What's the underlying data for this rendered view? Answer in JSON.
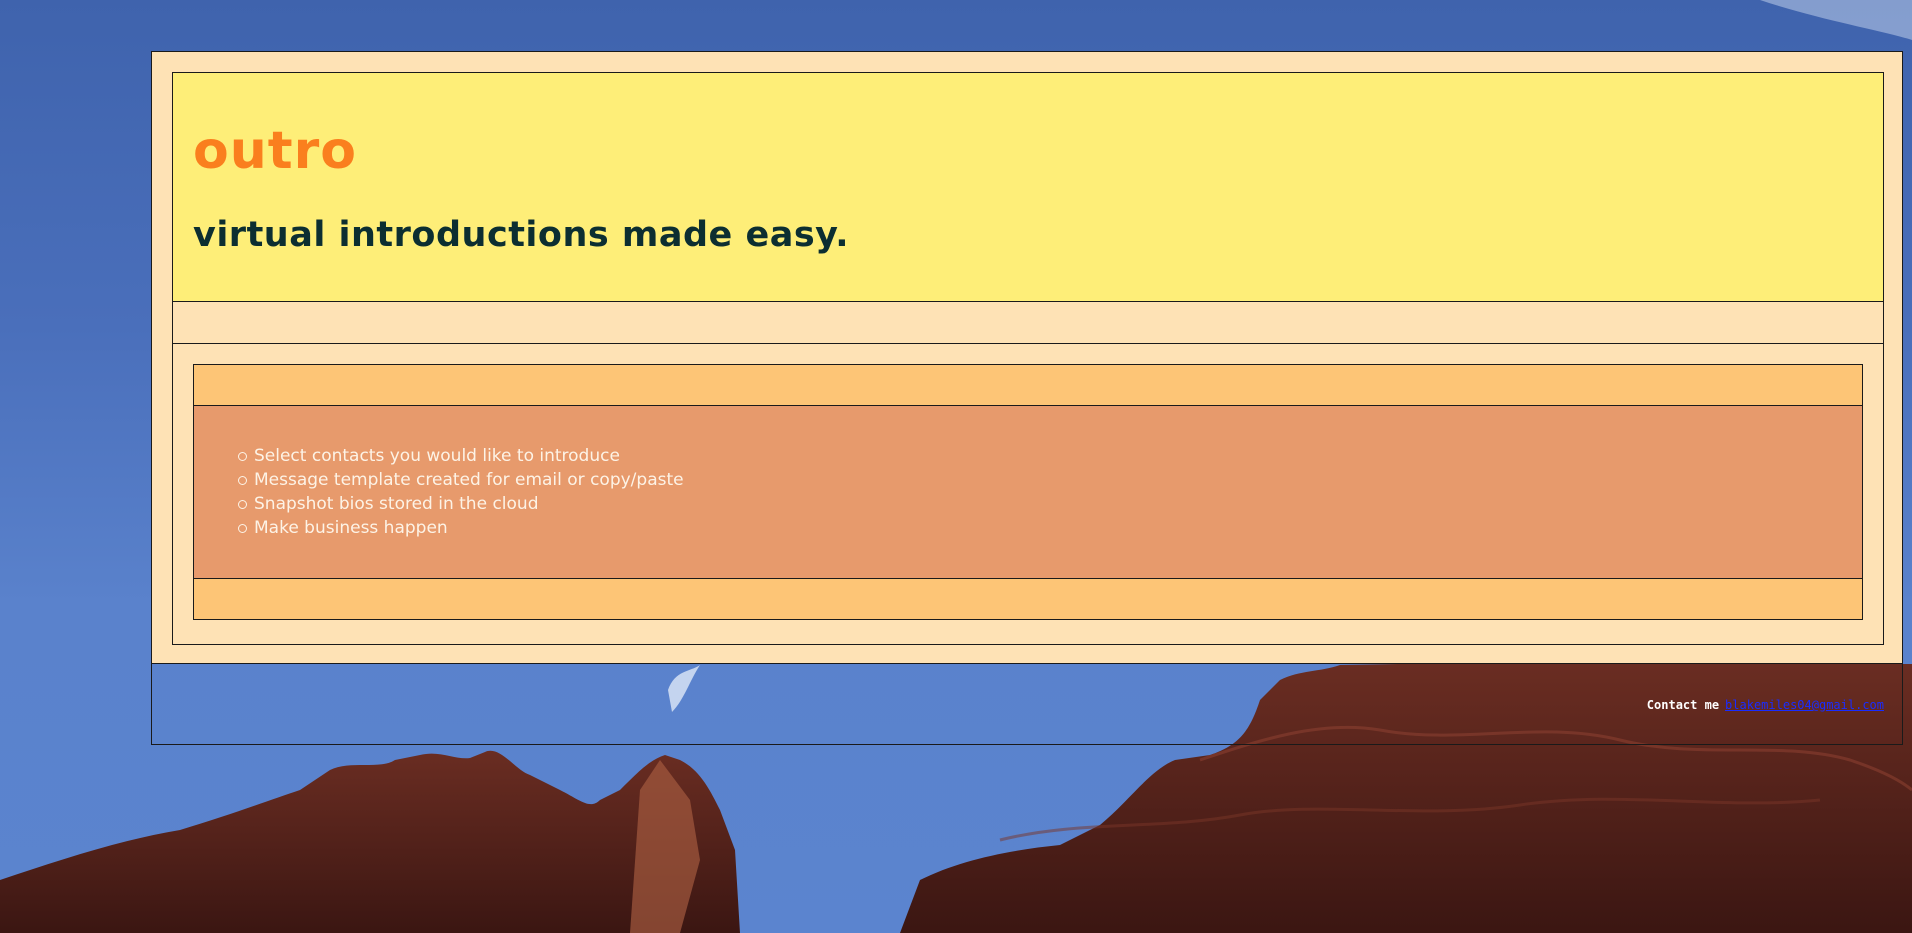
{
  "header": {
    "brand": "outro",
    "tagline": "virtual introductions made easy."
  },
  "features": {
    "items": [
      "Select contacts you would like to introduce",
      "Message template created for email or copy/paste",
      "Snapshot bios stored in the cloud",
      "Make business happen"
    ]
  },
  "footer": {
    "contact_label": "Contact me",
    "email": "blakemiles04@gmail.com"
  },
  "colors": {
    "frame_background": "#fee2b5",
    "header_background": "#feee78",
    "brand": "#fa7f1e",
    "tagline": "#0c2e31",
    "band": "#fdc576",
    "features_background": "#e79a6c",
    "link": "#1a2cff"
  }
}
